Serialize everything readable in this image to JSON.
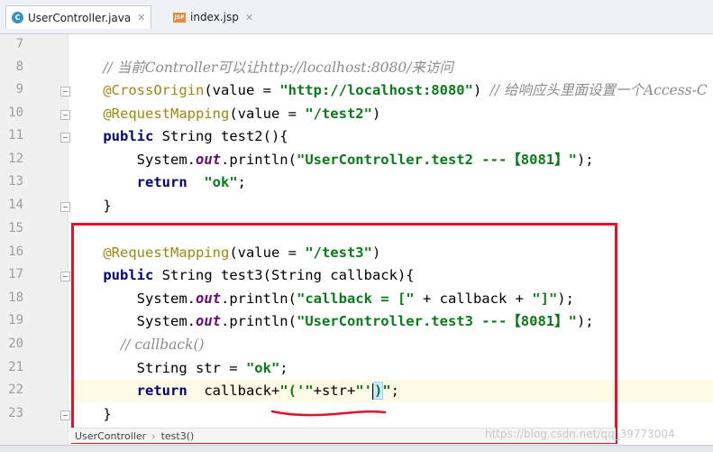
{
  "tabs": [
    {
      "label": "UserController.java",
      "icon": "java-class-icon",
      "active": true
    },
    {
      "label": "index.jsp",
      "icon": "jsp-file-icon",
      "active": false
    }
  ],
  "jsp_badge": "JSP",
  "line_numbers": [
    "7",
    "8",
    "9",
    "10",
    "11",
    "12",
    "13",
    "14",
    "15",
    "16",
    "17",
    "18",
    "19",
    "20",
    "21",
    "22",
    "23"
  ],
  "code": {
    "l8": "// 当前Controller可以让http://localhost:8080/来访问",
    "l9_ann": "@CrossOrigin",
    "l9_a": "(value = ",
    "l9_str": "\"http://localhost:8080\"",
    "l9_b": ") ",
    "l9_cmt": "// 给响应头里面设置一个Access-C",
    "l10_ann": "@RequestMapping",
    "l10_a": "(value = ",
    "l10_str": "\"/test2\"",
    "l10_b": ")",
    "l11_kw": "public",
    "l11_a": " String test2(){",
    "l12_a": "    System.",
    "l12_fld": "out",
    "l12_b": ".println(",
    "l12_str": "\"UserController.test2 ---【8081】\"",
    "l12_c": ");",
    "l13_kw": "    return",
    "l13_a": "  ",
    "l13_str": "\"ok\"",
    "l13_b": ";",
    "l14": "}",
    "l16_ann": "@RequestMapping",
    "l16_a": "(value = ",
    "l16_str": "\"/test3\"",
    "l16_b": ")",
    "l17_kw": "public",
    "l17_a": " String test3(String callback){",
    "l18_a": "    System.",
    "l18_fld": "out",
    "l18_b": ".println(",
    "l18_str1": "\"callback = [\"",
    "l18_c": " + callback + ",
    "l18_str2": "\"]\"",
    "l18_d": ");",
    "l19_a": "    System.",
    "l19_fld": "out",
    "l19_b": ".println(",
    "l19_str": "\"UserController.test3 ---【8081】\"",
    "l19_c": ");",
    "l20_cmt": "    // callback()",
    "l21_a": "    String str = ",
    "l21_str": "\"ok\"",
    "l21_b": ";",
    "l22_kw": "    return",
    "l22_a": "  callback+",
    "l22_str1": "\"('\"",
    "l22_b": "+str+",
    "l22_str2": "\"'",
    "l22_brk": ")",
    "l22_str3": "\"",
    "l22_c": ";",
    "l23": "}"
  },
  "breadcrumb": [
    "UserController",
    "test3()"
  ],
  "watermark": "https://blog.csdn.net/qq_39773004",
  "colors": {
    "highlight_box": "#e5102a",
    "annotation": "#9e880d",
    "keyword": "#000080",
    "string": "#067d17"
  }
}
